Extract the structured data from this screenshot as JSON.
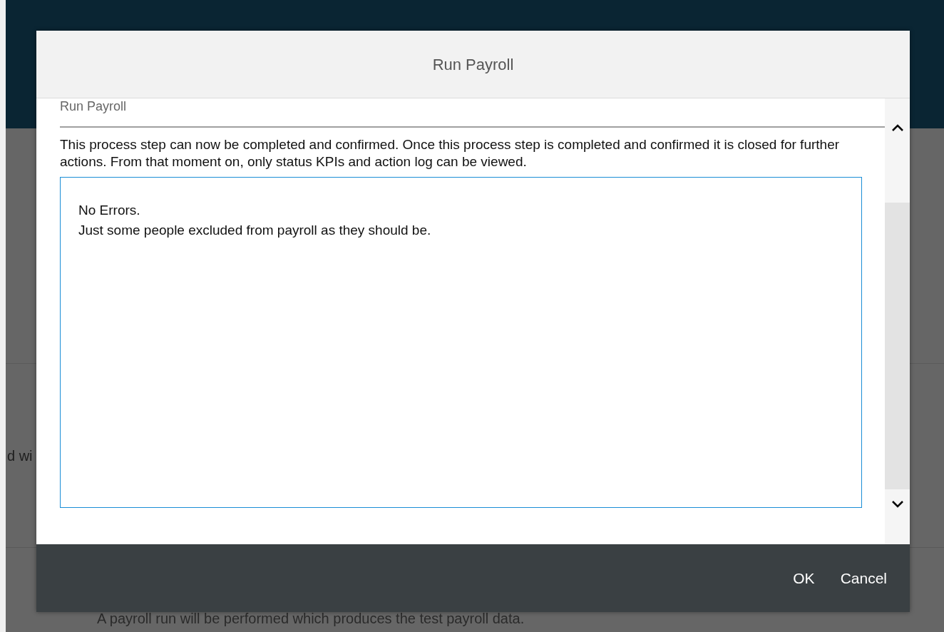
{
  "background": {
    "partial_text": "d wi",
    "description": "A payroll run will be performed which produces the test payroll data."
  },
  "dialog": {
    "title": "Run Payroll",
    "section_title": "Run Payroll",
    "message": "This process step can now be completed and confirmed. Once this process step is completed and confirmed it is closed for further actions. From that moment on, only status KPIs and action log can be viewed.",
    "comment": "No Errors.\nJust some people excluded from payroll as they should be.",
    "buttons": [
      "OK",
      "Cancel"
    ]
  }
}
